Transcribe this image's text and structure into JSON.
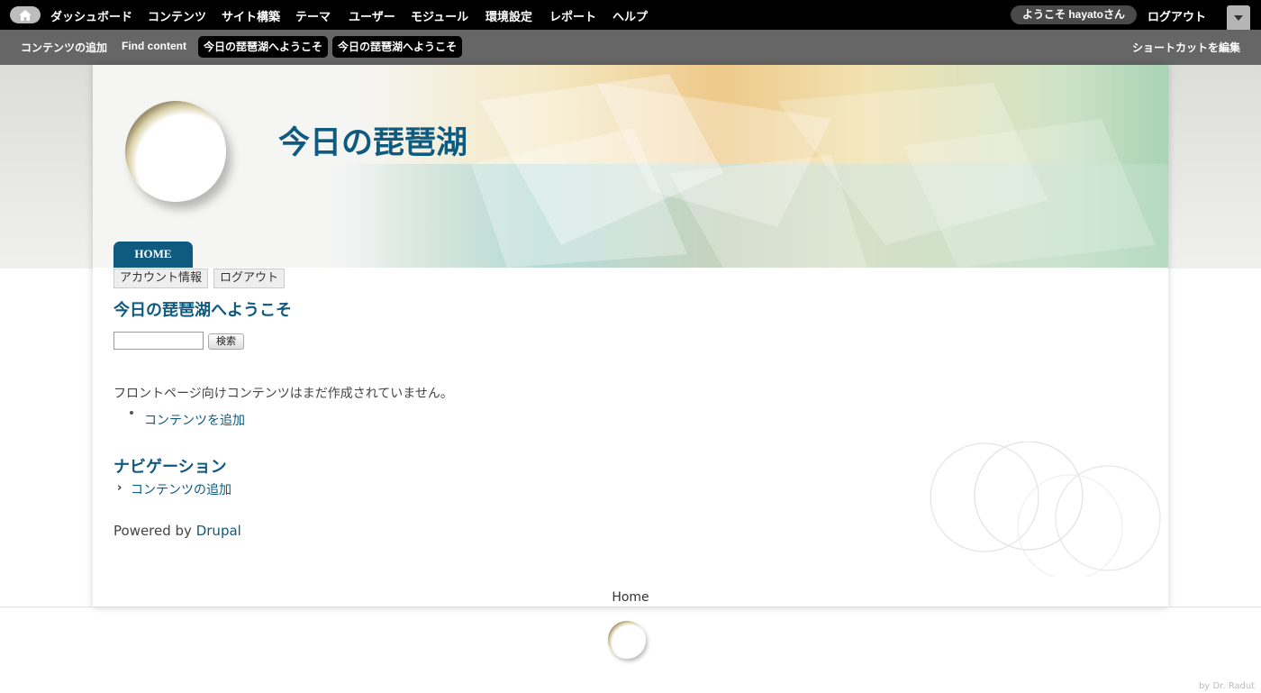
{
  "toolbar": {
    "menu": [
      "ダッシュボード",
      "コンテンツ",
      "サイト構築",
      "テーマ",
      "ユーザー",
      "モジュール",
      "環境設定",
      "レポート",
      "ヘルプ"
    ],
    "greeting": "ようこそ hayatoさん",
    "logout": "ログアウト"
  },
  "shortcuts": {
    "items": [
      "コンテンツの追加",
      "Find content"
    ],
    "pills": [
      "今日の琵琶湖へようこそ",
      "今日の琵琶湖へようこそ"
    ],
    "edit": "ショートカットを編集"
  },
  "site": {
    "name": "今日の琵琶湖"
  },
  "nav": {
    "home_tab": "HOME",
    "secondary": [
      "アカウント情報",
      "ログアウト"
    ]
  },
  "main": {
    "welcome_title": "今日の琵琶湖へようこそ",
    "search_button": "検索",
    "empty_message": "フロントページ向けコンテンツはまだ作成されていません。",
    "add_content_link": "コンテンツを追加"
  },
  "navigation_block": {
    "title": "ナビゲーション",
    "items": [
      "コンテンツの追加"
    ]
  },
  "powered": {
    "prefix": "Powered by ",
    "link": "Drupal"
  },
  "footer": {
    "home_link": "Home",
    "credit": "by Dr. Radut"
  },
  "icons": {
    "home": "home-icon",
    "drawer": "chevron-down-icon",
    "nav_bullet": "chevron-right-icon"
  },
  "colors": {
    "accent": "#0f5a7f",
    "toolbar": "#000000",
    "shortcut_bar": "#666666"
  }
}
